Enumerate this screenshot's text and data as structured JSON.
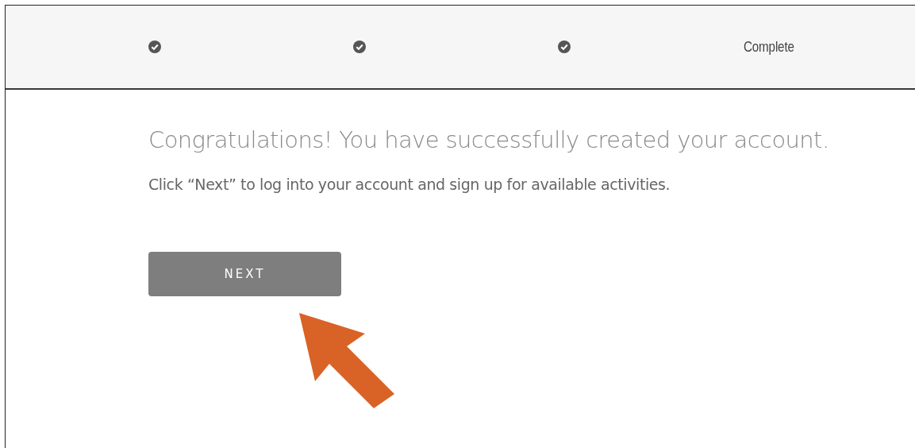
{
  "steps": [
    {
      "completed": true
    },
    {
      "completed": true
    },
    {
      "completed": true
    },
    {
      "completed": false,
      "label": "Complete"
    }
  ],
  "heading": "Congratulations! You have successfully created your account.",
  "message": "Click “Next” to log into your account and sign up for available activities.",
  "next_button": "NEXT"
}
